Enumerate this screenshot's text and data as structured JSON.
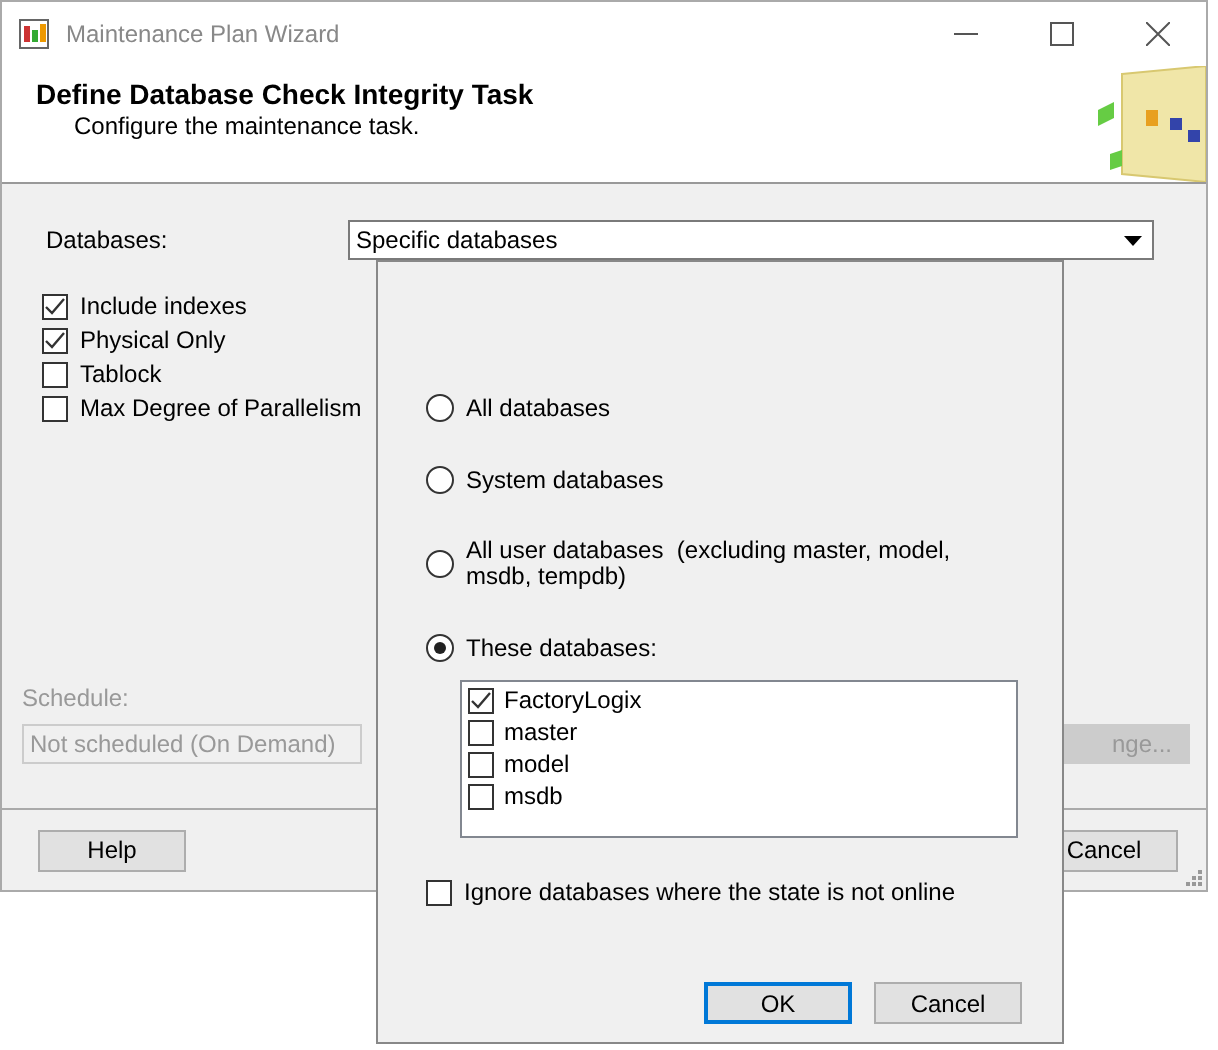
{
  "window": {
    "title": "Maintenance Plan Wizard"
  },
  "header": {
    "title": "Define Database Check Integrity Task",
    "subtitle": "Configure the maintenance task."
  },
  "databases": {
    "label": "Databases:",
    "value": "Specific databases"
  },
  "options": [
    {
      "label": "Include indexes",
      "checked": true
    },
    {
      "label": "Physical Only",
      "checked": true
    },
    {
      "label": "Tablock",
      "checked": false
    },
    {
      "label": "Max Degree of Parallelism",
      "checked": false
    }
  ],
  "schedule": {
    "label": "Schedule:",
    "value": "Not scheduled (On Demand)",
    "change_button": "nge...",
    "disabled": true
  },
  "buttons": {
    "help": "Help",
    "cancel": "Cancel"
  },
  "popup": {
    "options": [
      {
        "label": "All databases",
        "selected": false
      },
      {
        "label": "System databases",
        "selected": false
      },
      {
        "label": "All user databases  (excluding master, model, msdb, tempdb)",
        "selected": false
      },
      {
        "label": "These databases:",
        "selected": true
      }
    ],
    "databases": [
      {
        "name": "FactoryLogix",
        "checked": true
      },
      {
        "name": "master",
        "checked": false
      },
      {
        "name": "model",
        "checked": false
      },
      {
        "name": "msdb",
        "checked": false
      }
    ],
    "ignore_offline": {
      "label": "Ignore databases where the state is not online",
      "checked": false
    },
    "ok": "OK",
    "cancel": "Cancel"
  }
}
